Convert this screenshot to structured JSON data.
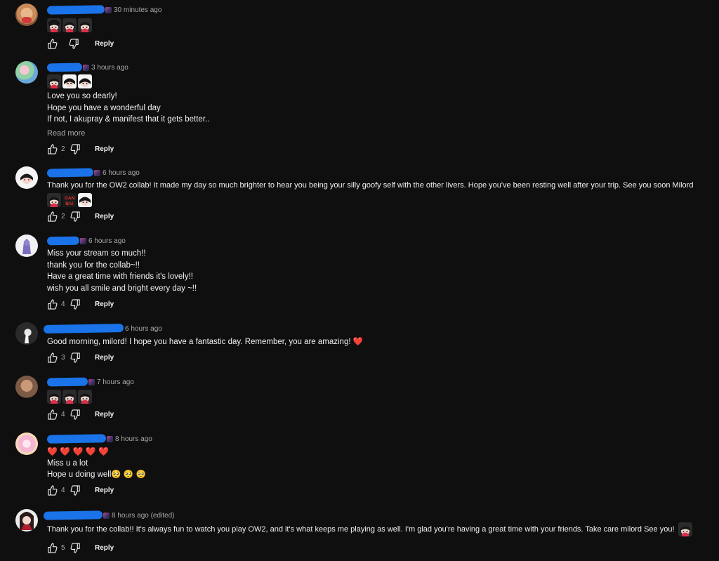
{
  "reply_label": "Reply",
  "read_more_label": "Read more",
  "colors": {
    "background": "#0f0f0f",
    "text": "#f1f1f1",
    "secondary": "#aaaaaa",
    "redaction": "#1a73e8",
    "heart": "#e8393f"
  },
  "comments": [
    {
      "author": "",
      "time": "30 minutes ago",
      "lines": [],
      "emotes": [
        "emote-chibi",
        "emote-chibi",
        "emote-chibi"
      ],
      "likes": "",
      "avatar": "cat-avatar"
    },
    {
      "author": "",
      "time": "3 hours ago",
      "lines": [
        "Love you so dearly!",
        "Hope you have a wonderful day",
        "If not, I akupray & manifest that it gets better.."
      ],
      "emotes": [
        "emote-chibi",
        "emote-chibi-dark",
        "emote-chibi-dark"
      ],
      "likes": "2",
      "read_more": true,
      "avatar": "flower-avatar"
    },
    {
      "author": "",
      "time": "6 hours ago",
      "lines": [
        "Thank you for the OW2 collab! It made my day so much brighter to hear you being your silly goofy self with the other livers. Hope you've been resting well after your trip. See you soon Milord"
      ],
      "emotes": [
        "emote-chibi",
        "emote-ganbare",
        "emote-chibi-dark"
      ],
      "likes": "2",
      "avatar": "chibi-avatar"
    },
    {
      "author": "",
      "time": "6 hours ago",
      "lines": [
        "Miss your stream so much!!",
        "thank you for the collab~!!",
        "Have a great time with friends it's lovely!!",
        "wish you all smile and bright every day ~!!"
      ],
      "emotes": [],
      "likes": "4",
      "avatar": "purple-avatar"
    },
    {
      "author": "",
      "time": "6 hours ago",
      "lines": [
        "Good morning, milord! I hope you have a fantastic day. Remember, you are amazing! ❤️"
      ],
      "emotes": [],
      "likes": "3",
      "avatar": "dark-avatar"
    },
    {
      "author": "",
      "time": "7 hours ago",
      "lines": [],
      "emotes": [
        "emote-chibi",
        "emote-chibi",
        "emote-chibi"
      ],
      "likes": "4",
      "avatar": "bear-avatar"
    },
    {
      "author": "",
      "time": "8 hours ago",
      "lines": [
        "❤️ ❤️ ❤️ ❤️ ❤️",
        "Miss u a lot",
        "Hope u doing well🥺 🥺 🥺"
      ],
      "emotes": [],
      "likes": "4",
      "avatar": "pastel-avatar"
    },
    {
      "author": "",
      "time": "8 hours ago (edited)",
      "lines": [
        "Thank you for the collab!! It's always fun to watch you play OW2, and it's what keeps me playing as well. I'm glad you're having a great time with your friends. Take care milord See you!"
      ],
      "emotes": [],
      "likes": "5",
      "trailing_emote": "emote-chibi",
      "avatar": "anime-avatar"
    }
  ]
}
